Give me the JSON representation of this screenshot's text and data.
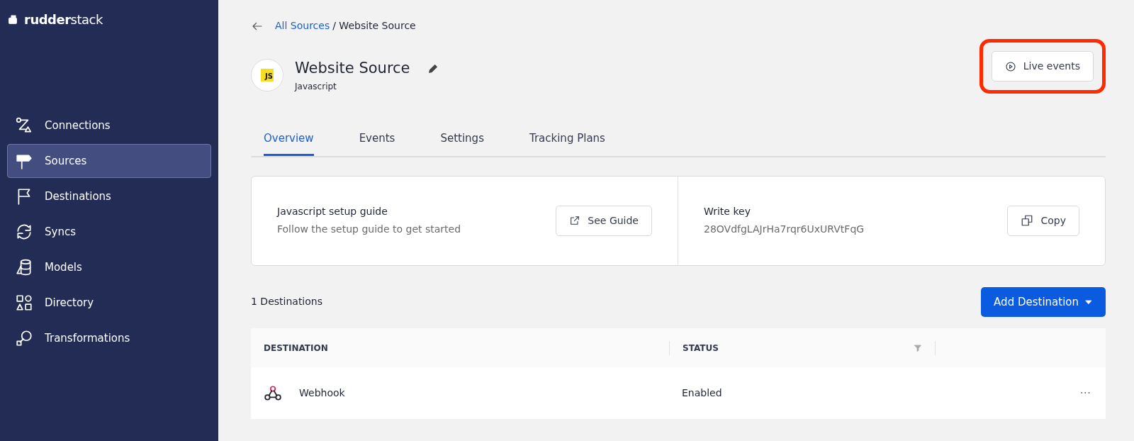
{
  "sidebar": {
    "logo": {
      "bold": "rudder",
      "light": "stack"
    },
    "items": [
      {
        "label": "Connections",
        "selected": false
      },
      {
        "label": "Sources",
        "selected": true
      },
      {
        "label": "Destinations",
        "selected": false
      },
      {
        "label": "Syncs",
        "selected": false
      },
      {
        "label": "Models",
        "selected": false
      },
      {
        "label": "Directory",
        "selected": false
      },
      {
        "label": "Transformations",
        "selected": false
      }
    ]
  },
  "breadcrumb": {
    "link": "All Sources",
    "current": "/ Website Source"
  },
  "source": {
    "badge": "JS",
    "title": "Website Source",
    "subtitle": "Javascript"
  },
  "live_events": {
    "label": "Live events",
    "highlighted": true
  },
  "tabs": [
    {
      "label": "Overview",
      "selected": true
    },
    {
      "label": "Events",
      "selected": false
    },
    {
      "label": "Settings",
      "selected": false
    },
    {
      "label": "Tracking Plans",
      "selected": false
    }
  ],
  "setup": {
    "title": "Javascript setup guide",
    "text": "Follow the setup guide to get started",
    "button": "See Guide"
  },
  "write_key": {
    "title": "Write key",
    "value": "28OVdfgLAJrHa7rqr6UxURVtFqG",
    "button": "Copy"
  },
  "destinations": {
    "count": "1 Destinations",
    "add_button": "Add Destination",
    "table": {
      "columns": [
        "DESTINATION",
        "STATUS"
      ],
      "rows": [
        {
          "name": "Webhook",
          "status": "Enabled",
          "menu": "···"
        }
      ]
    }
  }
}
